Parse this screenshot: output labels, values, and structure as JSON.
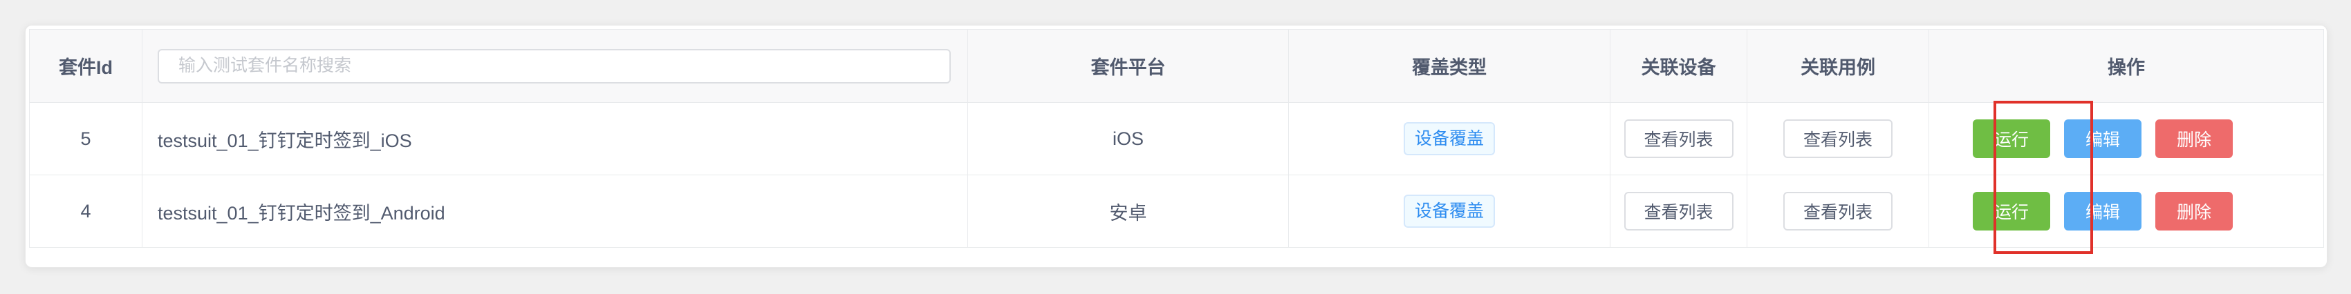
{
  "table": {
    "headers": {
      "id": "套件Id",
      "platform": "套件平台",
      "coverage": "覆盖类型",
      "devices": "关联设备",
      "cases": "关联用例",
      "actions": "操作"
    },
    "search": {
      "placeholder": "输入测试套件名称搜索",
      "value": ""
    },
    "rows": [
      {
        "id": "5",
        "name": "testsuit_01_钉钉定时签到_iOS",
        "platform": "iOS",
        "coverage": "设备覆盖",
        "devices_button": "查看列表",
        "cases_button": "查看列表",
        "run": "运行",
        "edit": "编辑",
        "delete": "删除"
      },
      {
        "id": "4",
        "name": "testsuit_01_钉钉定时签到_Android",
        "platform": "安卓",
        "coverage": "设备覆盖",
        "devices_button": "查看列表",
        "cases_button": "查看列表",
        "run": "运行",
        "edit": "编辑",
        "delete": "删除"
      }
    ]
  },
  "colors": {
    "run": "#6fbe44",
    "edit": "#5cadf5",
    "delete": "#ee6b6b",
    "tag": "#2d8cf0",
    "highlight": "#e0312a"
  }
}
